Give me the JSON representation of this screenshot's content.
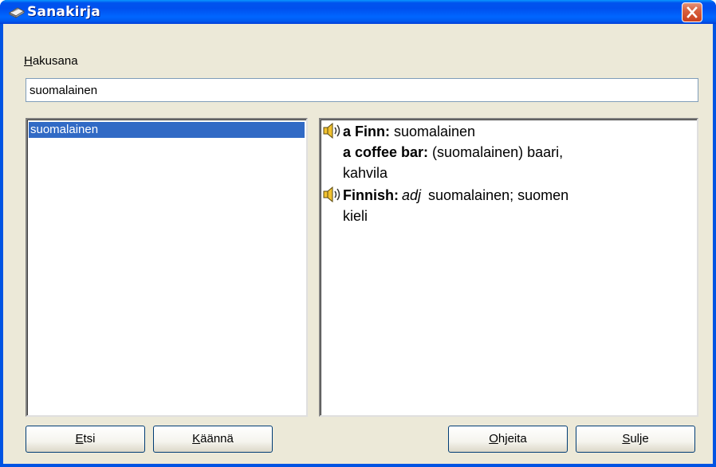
{
  "window": {
    "title": "Sanakirja",
    "icon": "dictionary-book-icon",
    "close_icon": "close-x-icon",
    "close_color": "#d8613f"
  },
  "search": {
    "label_accel": "H",
    "label_rest": "akusana",
    "value": "suomalainen"
  },
  "word_list": {
    "items": [
      "suomalainen"
    ],
    "selected_color": "#316ac5"
  },
  "result": {
    "entries": [
      {
        "headword": "a Finn:",
        "translation": " suomalainen",
        "speaker": true
      },
      {
        "headword": "a coffee bar:",
        "translation": " (suomalainen) baari,",
        "speaker": false
      },
      {
        "continuation": "kahvila"
      },
      {
        "headword": "Finnish:",
        "pos": "adj",
        "translation": " suomalainen; suomen",
        "speaker": true
      },
      {
        "continuation": "kieli"
      }
    ]
  },
  "buttons": {
    "etsi": {
      "accel": "E",
      "rest": "tsi"
    },
    "kaanna": {
      "accel": "K",
      "rest": "äännä"
    },
    "ohjeita": {
      "accel": "O",
      "rest": "hjeita"
    },
    "sulje": {
      "accel": "S",
      "rest": "ulje"
    }
  }
}
